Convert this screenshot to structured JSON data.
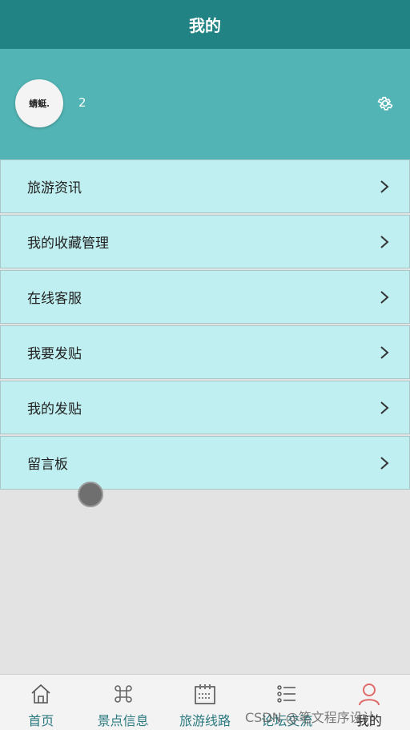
{
  "header": {
    "title": "我的"
  },
  "profile": {
    "avatar_text": "蜻蜓.",
    "username": "2"
  },
  "menu": [
    {
      "label": "旅游资讯"
    },
    {
      "label": "我的收藏管理"
    },
    {
      "label": "在线客服"
    },
    {
      "label": "我要发贴"
    },
    {
      "label": "我的发贴"
    },
    {
      "label": "留言板"
    }
  ],
  "tabs": [
    {
      "label": "首页",
      "icon": "home-icon"
    },
    {
      "label": "景点信息",
      "icon": "command-icon"
    },
    {
      "label": "旅游线路",
      "icon": "calendar-icon"
    },
    {
      "label": "论坛交流",
      "icon": "list-icon"
    },
    {
      "label": "我的",
      "icon": "user-icon"
    }
  ],
  "watermark": "CSDN @笔文程序设计",
  "colors": {
    "header": "#218383",
    "profile_bg": "#52b4b4",
    "menu_bg": "#bfeff0",
    "tab_active_icon": "#e06a6a"
  }
}
